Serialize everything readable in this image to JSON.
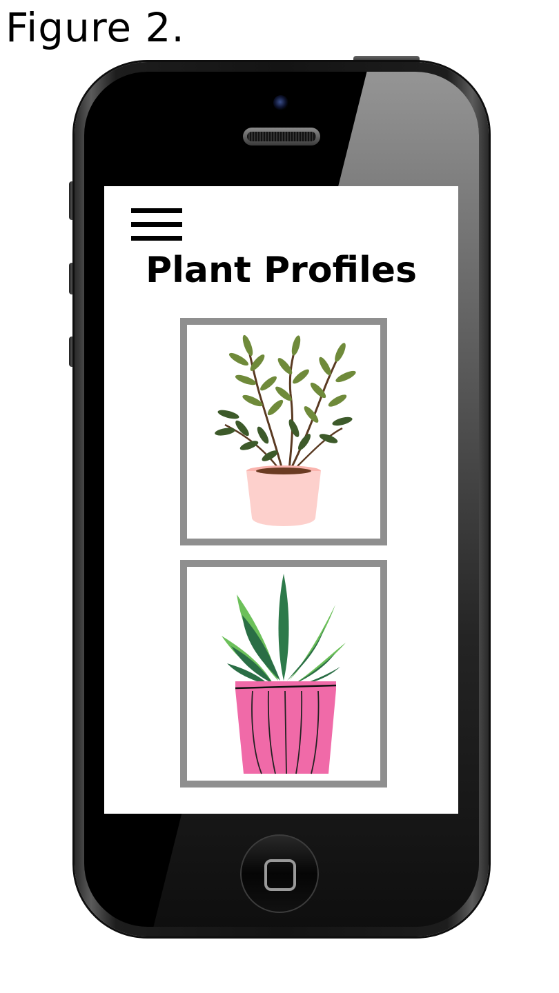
{
  "caption": "Figure 2.",
  "app": {
    "title": "Plant Profiles",
    "menu_icon": "hamburger-menu-icon",
    "cards": [
      {
        "icon": "leafy-plant-pink-pot-icon",
        "pot_color": "#fdd0cc"
      },
      {
        "icon": "aloe-plant-pink-pot-icon",
        "pot_color": "#f06aa8"
      }
    ]
  },
  "colors": {
    "card_border": "#8f8f8f",
    "phone_body": "#141414"
  }
}
